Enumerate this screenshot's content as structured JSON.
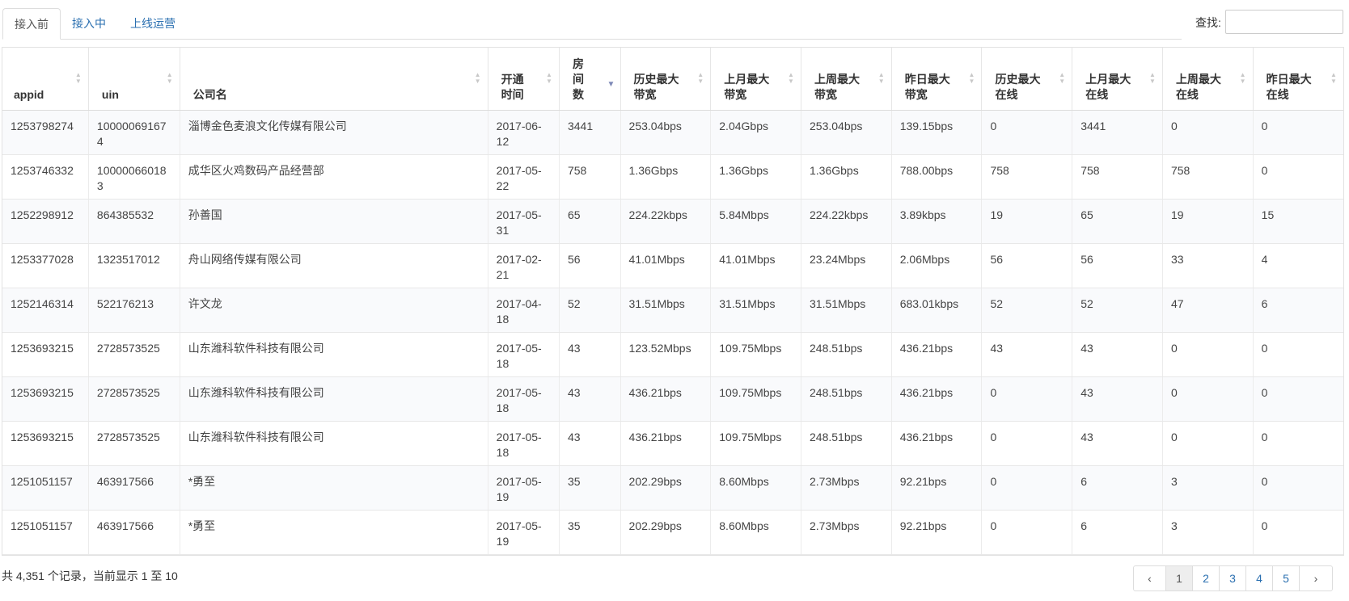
{
  "tabs": [
    {
      "label": "接入前",
      "active": true
    },
    {
      "label": "接入中",
      "active": false
    },
    {
      "label": "上线运营",
      "active": false
    }
  ],
  "search": {
    "label": "查找:",
    "value": ""
  },
  "table": {
    "headers": [
      "appid",
      "uin",
      "公司名",
      "开通时间",
      "房间数",
      "历史最大带宽",
      "上月最大带宽",
      "上周最大带宽",
      "昨日最大带宽",
      "历史最大在线",
      "上月最大在线",
      "上周最大在线",
      "昨日最大在线"
    ],
    "rows": [
      [
        "1253798274",
        "100000691674",
        "淄博金色麦浪文化传媒有限公司",
        "2017-06-12",
        "3441",
        "253.04bps",
        "2.04Gbps",
        "253.04bps",
        "139.15bps",
        "0",
        "3441",
        "0",
        "0"
      ],
      [
        "1253746332",
        "100000660183",
        "成华区火鸡数码产品经营部",
        "2017-05-22",
        "758",
        "1.36Gbps",
        "1.36Gbps",
        "1.36Gbps",
        "788.00bps",
        "758",
        "758",
        "758",
        "0"
      ],
      [
        "1252298912",
        "864385532",
        "孙善国",
        "2017-05-31",
        "65",
        "224.22kbps",
        "5.84Mbps",
        "224.22kbps",
        "3.89kbps",
        "19",
        "65",
        "19",
        "15"
      ],
      [
        "1253377028",
        "1323517012",
        "舟山网络传媒有限公司",
        "2017-02-21",
        "56",
        "41.01Mbps",
        "41.01Mbps",
        "23.24Mbps",
        "2.06Mbps",
        "56",
        "56",
        "33",
        "4"
      ],
      [
        "1252146314",
        "522176213",
        "许文龙",
        "2017-04-18",
        "52",
        "31.51Mbps",
        "31.51Mbps",
        "31.51Mbps",
        "683.01kbps",
        "52",
        "52",
        "47",
        "6"
      ],
      [
        "1253693215",
        "2728573525",
        "山东潍科软件科技有限公司",
        "2017-05-18",
        "43",
        "123.52Mbps",
        "109.75Mbps",
        "248.51bps",
        "436.21bps",
        "43",
        "43",
        "0",
        "0"
      ],
      [
        "1253693215",
        "2728573525",
        "山东潍科软件科技有限公司",
        "2017-05-18",
        "43",
        "436.21bps",
        "109.75Mbps",
        "248.51bps",
        "436.21bps",
        "0",
        "43",
        "0",
        "0"
      ],
      [
        "1253693215",
        "2728573525",
        "山东潍科软件科技有限公司",
        "2017-05-18",
        "43",
        "436.21bps",
        "109.75Mbps",
        "248.51bps",
        "436.21bps",
        "0",
        "43",
        "0",
        "0"
      ],
      [
        "1251051157",
        "463917566",
        "*勇至",
        "2017-05-19",
        "35",
        "202.29bps",
        "8.60Mbps",
        "2.73Mbps",
        "92.21bps",
        "0",
        "6",
        "3",
        "0"
      ],
      [
        "1251051157",
        "463917566",
        "*勇至",
        "2017-05-19",
        "35",
        "202.29bps",
        "8.60Mbps",
        "2.73Mbps",
        "92.21bps",
        "0",
        "6",
        "3",
        "0"
      ]
    ]
  },
  "footer": {
    "records_info": "共 4,351 个记录，当前显示 1 至 10"
  },
  "pagination": {
    "prev": "‹",
    "next": "›",
    "pages": [
      "1",
      "2",
      "3",
      "4",
      "5"
    ],
    "current": "1"
  },
  "icons": {
    "sort": "sort-icon",
    "sort_desc": "sort-desc-icon",
    "prev": "chevron-left-icon",
    "next": "chevron-right-icon"
  }
}
